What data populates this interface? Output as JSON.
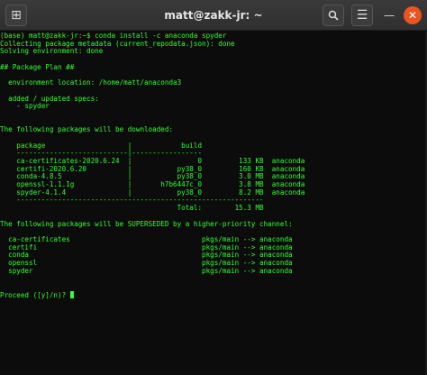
{
  "window": {
    "title": "matt@zakk-jr: ~",
    "colors": {
      "terminal_text": "#33ff33",
      "terminal_bg": "#0c0c0c",
      "close_button": "#e95420"
    }
  },
  "titlebar": {
    "new_tab_icon": "⊞",
    "search_icon": "🔍",
    "menu_icon": "☰",
    "minimize_icon": "—",
    "close_icon": "✕"
  },
  "terminal": {
    "lines": [
      "(base) matt@zakk-jr:~$ conda install -c anaconda spyder",
      "Collecting package metadata (current_repodata.json): done",
      "Solving environment: done",
      "",
      "## Package Plan ##",
      "",
      "  environment location: /home/matt/anaconda3",
      "",
      "  added / updated specs:",
      "    - spyder",
      "",
      "",
      "The following packages will be downloaded:",
      "",
      "    package                    |            build",
      "    ---------------------------|-----------------",
      "    ca-certificates-2020.6.24  |                0         133 KB  anaconda",
      "    certifi-2020.6.20          |           py38_0         160 KB  anaconda",
      "    conda-4.8.5                |           py38_0         3.0 MB  anaconda",
      "    openssl-1.1.1g             |       h7b6447c_0         3.8 MB  anaconda",
      "    spyder-4.1.4               |           py38_0         8.2 MB  anaconda",
      "    ------------------------------------------------------------",
      "                                           Total:        15.3 MB",
      "",
      "The following packages will be SUPERSEDED by a higher-priority channel:",
      "",
      "  ca-certificates                                pkgs/main --> anaconda",
      "  certifi                                        pkgs/main --> anaconda",
      "  conda                                          pkgs/main --> anaconda",
      "  openssl                                        pkgs/main --> anaconda",
      "  spyder                                         pkgs/main --> anaconda",
      "",
      "",
      "Proceed ([y]/n)? "
    ]
  }
}
